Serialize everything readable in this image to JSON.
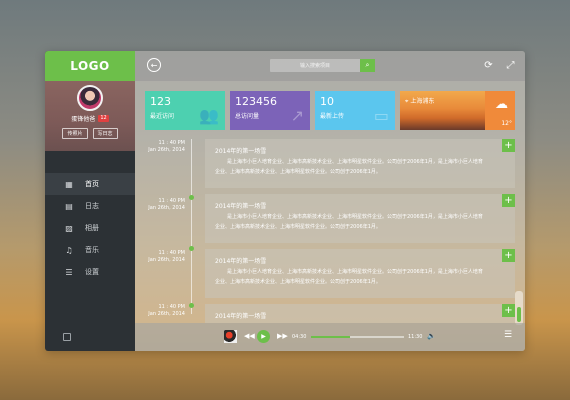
{
  "app": {
    "logo": "LOGO"
  },
  "profile": {
    "username": "蛋锋他爸",
    "badge_count": "12",
    "btn_photos": "传照片",
    "btn_log": "写日志"
  },
  "nav": [
    {
      "icon": "grid-icon",
      "label": "首页"
    },
    {
      "icon": "document-icon",
      "label": "日志"
    },
    {
      "icon": "album-icon",
      "label": "相册"
    },
    {
      "icon": "music-icon",
      "label": "音乐"
    },
    {
      "icon": "sliders-icon",
      "label": "设置"
    }
  ],
  "search": {
    "placeholder": "输入搜索项目"
  },
  "stats": [
    {
      "value": "123",
      "label": "最近访问",
      "color": "#4dd0b0",
      "icon": "users-icon"
    },
    {
      "value": "123456",
      "label": "总访问量",
      "color": "#7c63b8",
      "icon": "trend-chart-icon"
    },
    {
      "value": "10",
      "label": "最新上传",
      "color": "#5bc6ee",
      "icon": "tray-icon"
    }
  ],
  "weather": {
    "location": "上海浦东",
    "temp": "12°",
    "tile_color": "#f08a3a"
  },
  "timeline": [
    {
      "time": "11 : 40 PM",
      "date": "Jan 26th, 2014",
      "title": "2014年的第一场雪",
      "body": "是上海市小巨人培育企业、上海市高新技术企业、上海市明星软件企业。公司创于2006年1月，是上海市小巨人培育企业、上海市高新技术企业、上海市明星软件企业。公司创于2006年1月。"
    },
    {
      "time": "11 : 40 PM",
      "date": "Jan 26th, 2014",
      "title": "2014年的第一场雪",
      "body": "是上海市小巨人培育企业、上海市高新技术企业、上海市明星软件企业。公司创于2006年1月，是上海市小巨人培育企业、上海市高新技术企业、上海市明星软件企业。公司创于2006年1月。"
    },
    {
      "time": "11 : 40 PM",
      "date": "Jan 26th, 2014",
      "title": "2014年的第一场雪",
      "body": "是上海市小巨人培育企业、上海市高新技术企业、上海市明星软件企业。公司创于2006年1月，是上海市小巨人培育企业、上海市高新技术企业、上海市明星软件企业。公司创于2006年1月。"
    },
    {
      "time": "11 : 40 PM",
      "date": "Jan 26th, 2014",
      "title": "2014年的第一场雪",
      "body": ""
    }
  ],
  "player": {
    "current_time": "04:30",
    "total_time": "11:30",
    "progress": 0.42,
    "volume": 0.55
  },
  "colors": {
    "accent": "#6dbf4a",
    "sidebar": "#2c3135"
  }
}
